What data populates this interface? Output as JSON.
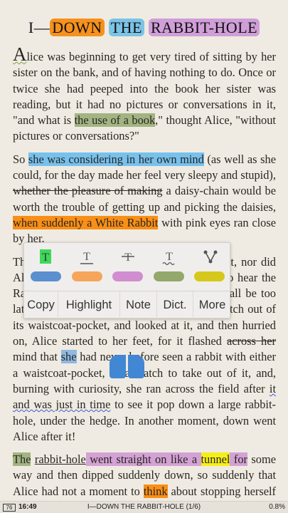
{
  "chapter_title": {
    "prefix": "I—",
    "part1": "DOWN",
    "part2": "THE",
    "part3": "RABBIT-HOLE"
  },
  "paragraphs": {
    "p1": {
      "dropcap": "A",
      "t1": "lice was beginning to get very tired of sitting by her sister on the bank, and of having nothing to do. Once or twice she had peeped into the book her sister was reading, but it had no pictures or conversations in it, \"and what is ",
      "hl1": "the use of a book",
      "t2": ",\" thought Alice, \"without pictures or conversations?\""
    },
    "p2": {
      "t0": "So ",
      "hl1": "she was considering in her own mind",
      "t1": " (as well as she could, for the day made her feel very sleepy and stupid), ",
      "strike": "whether the pleasure of making",
      "t2": " a daisy-chain would be worth the trouble of getting up and picking the daisies, ",
      "hl2": "when suddenly a White Rabbit",
      "t3": " with pink eyes ran close by her."
    },
    "p3": {
      "t1": "There was nothing so very remarkable in that, nor did Alice think it so very much out of the way to hear the Rabbit say to itself, \"Oh dear! Oh dear! I shall be too late!\" but when the Rabbit actually took a watch out of its waistcoat-pocket, and looked at it, and then hurried on, Alice started to her feet, for it flashed ",
      "strike": "across her",
      "t2": " mind that ",
      "sel": "she",
      "t3": " had never before seen a rabbit with either a waistcoat-pocket, or a watch to take out of it, and, burning with curiosity, she ran across the field after ",
      "ul": "it and was just in time",
      "t4": " to see it pop down a large rabbit-hole, under the hedge. In another moment, down went Alice after it!"
    },
    "p4": {
      "hl_the": "The",
      "sp": " ",
      "ul_rh": "rabbit-hole",
      "hl_went": " went straight on like a ",
      "hl_tunnel": "tunnel",
      "hl_for": " for",
      "t1": " some way and then dipped suddenly down, so suddenly that Alice had not a moment to ",
      "hl_think": "think",
      "t2": " about stopping herself before she found herself falling"
    }
  },
  "popup": {
    "tools": [
      "highlight-tool",
      "underline-tool",
      "strikethrough-tool",
      "squiggly-tool",
      "share-tool"
    ],
    "colors": [
      "#5b8fd0",
      "#f6a65b",
      "#d08ed0",
      "#93a86a",
      "#d6c81a"
    ],
    "buttons": {
      "copy": "Copy",
      "highlight": "Highlight",
      "note": "Note",
      "dict": "Dict.",
      "more": "More"
    }
  },
  "status_bar": {
    "battery": "76",
    "time": "16:49",
    "chapter": "I—DOWN THE RABBIT-HOLE (1/6)",
    "progress": "0.8%"
  }
}
